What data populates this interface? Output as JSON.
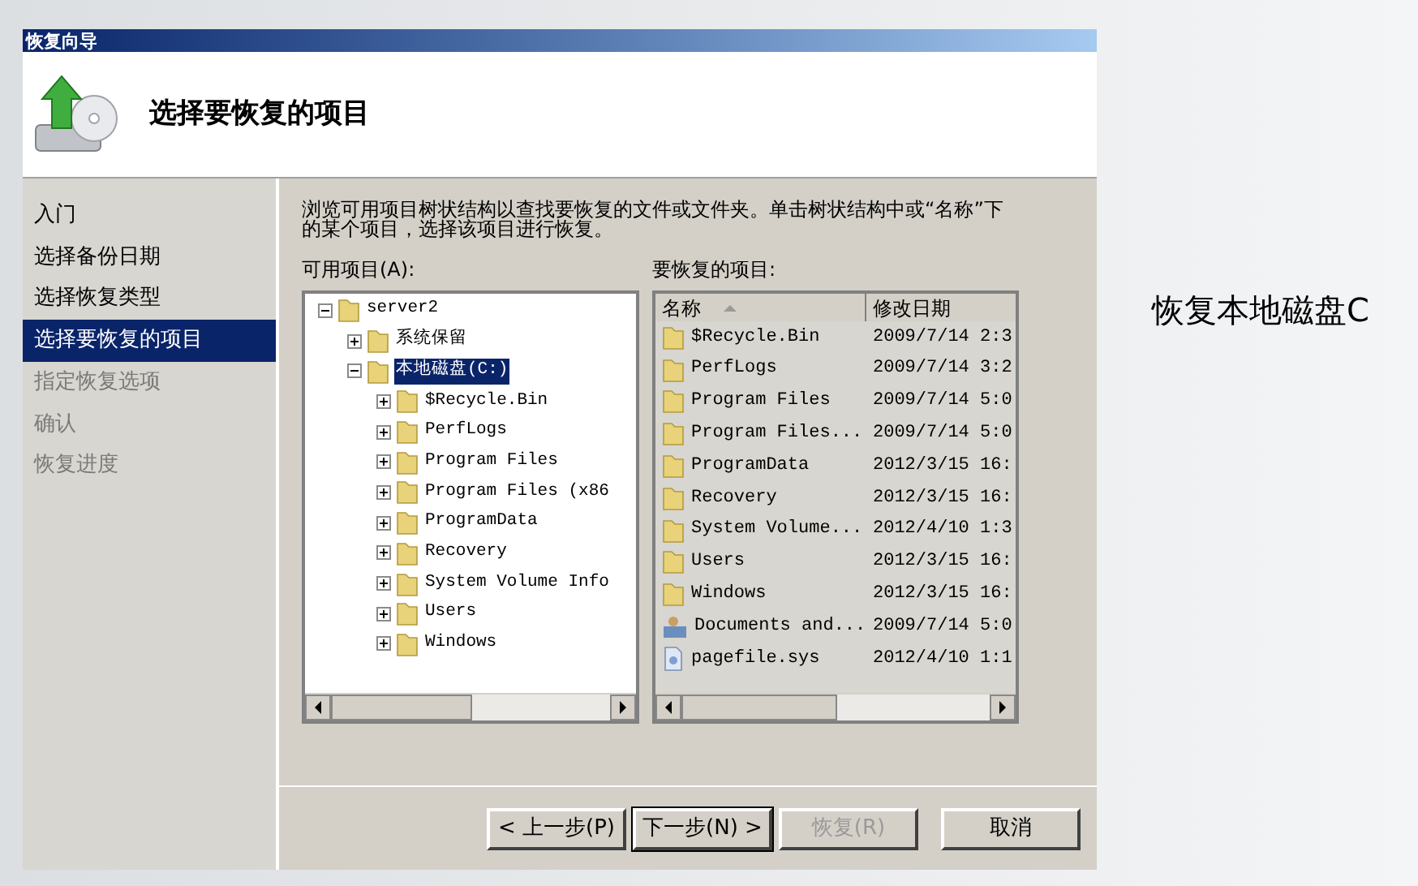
{
  "window": {
    "title": "恢复向导"
  },
  "header": {
    "title": "选择要恢复的项目"
  },
  "steps": [
    {
      "label": "入门",
      "selected": false,
      "disabled": false
    },
    {
      "label": "选择备份日期",
      "selected": false,
      "disabled": false
    },
    {
      "label": "选择恢复类型",
      "selected": false,
      "disabled": false
    },
    {
      "label": "选择要恢复的项目",
      "selected": true,
      "disabled": false
    },
    {
      "label": "指定恢复选项",
      "selected": false,
      "disabled": true
    },
    {
      "label": "确认",
      "selected": false,
      "disabled": true
    },
    {
      "label": "恢复进度",
      "selected": false,
      "disabled": true
    }
  ],
  "instructions": "浏览可用项目树状结构以查找要恢复的文件或文件夹。单击树状结构中或“名称”下的某个项目，选择该项目进行恢复。",
  "available_items": {
    "label": "可用项目(A):",
    "tree": [
      {
        "label": "server2",
        "expanded": true,
        "selected": false,
        "children": [
          {
            "label": "系统保留",
            "expanded": false,
            "selected": false
          },
          {
            "label": "本地磁盘(C:)",
            "expanded": true,
            "selected": true,
            "children": [
              {
                "label": "$Recycle.Bin",
                "expanded": false,
                "selected": false
              },
              {
                "label": "PerfLogs",
                "expanded": false,
                "selected": false
              },
              {
                "label": "Program Files",
                "expanded": false,
                "selected": false
              },
              {
                "label": "Program Files (x86",
                "expanded": false,
                "selected": false
              },
              {
                "label": "ProgramData",
                "expanded": false,
                "selected": false
              },
              {
                "label": "Recovery",
                "expanded": false,
                "selected": false
              },
              {
                "label": "System Volume Info",
                "expanded": false,
                "selected": false
              },
              {
                "label": "Users",
                "expanded": false,
                "selected": false
              },
              {
                "label": "Windows",
                "expanded": false,
                "selected": false
              }
            ]
          }
        ]
      }
    ]
  },
  "items_to_restore": {
    "label": "要恢复的项目:",
    "columns": [
      "名称",
      "修改日期"
    ],
    "rows": [
      {
        "kind": "folder",
        "name": "$Recycle.Bin",
        "date": "2009/7/14 2:3"
      },
      {
        "kind": "folder",
        "name": "PerfLogs",
        "date": "2009/7/14 3:2"
      },
      {
        "kind": "folder",
        "name": "Program Files",
        "date": "2009/7/14 5:0"
      },
      {
        "kind": "folder",
        "name": "Program Files...",
        "date": "2009/7/14 5:0"
      },
      {
        "kind": "folder",
        "name": "ProgramData",
        "date": "2012/3/15 16:"
      },
      {
        "kind": "folder",
        "name": "Recovery",
        "date": "2012/3/15 16:"
      },
      {
        "kind": "folder",
        "name": "System Volume...",
        "date": "2012/4/10 1:3"
      },
      {
        "kind": "folder",
        "name": "Users",
        "date": "2012/3/15 16:"
      },
      {
        "kind": "folder",
        "name": "Windows",
        "date": "2012/3/15 16:"
      },
      {
        "kind": "shortcut",
        "name": "Documents and...",
        "date": "2009/7/14 5:0"
      },
      {
        "kind": "file",
        "name": "pagefile.sys",
        "date": "2012/4/10 1:1"
      }
    ]
  },
  "buttons": [
    {
      "label": "< 上一步(P)",
      "disabled": false,
      "default": false
    },
    {
      "label": "下一步(N) >",
      "disabled": false,
      "default": true
    },
    {
      "label": "恢复(R)",
      "disabled": true,
      "default": false
    },
    {
      "label": "取消",
      "disabled": false,
      "default": false
    }
  ],
  "caption": "恢复本地磁盘C"
}
